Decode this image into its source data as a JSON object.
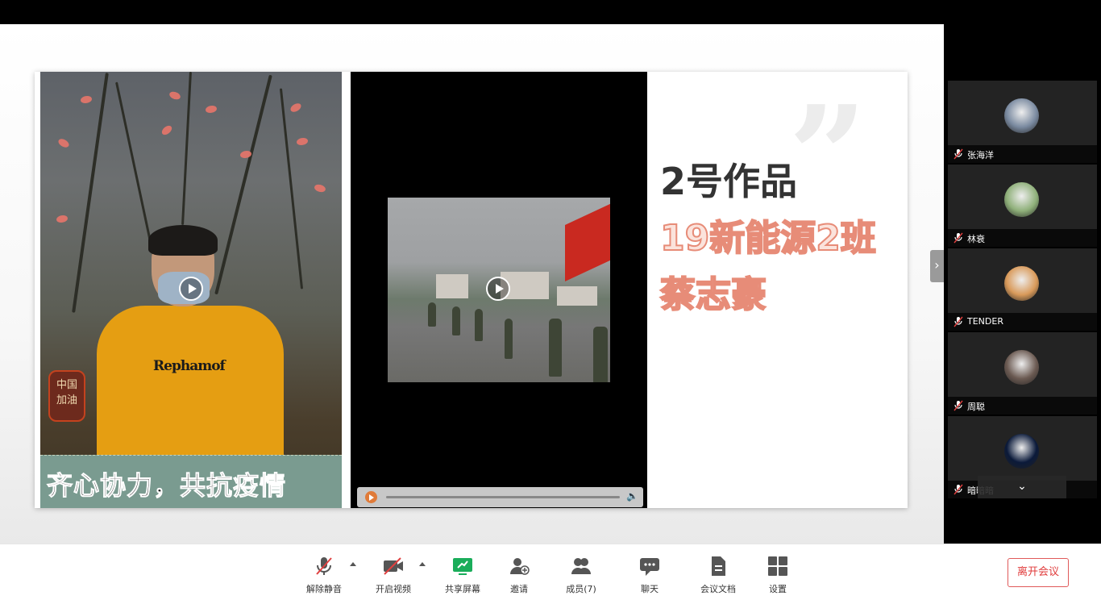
{
  "slide": {
    "caption": "齐心协力，共抗疫情",
    "emblem_text": "中国\n加油",
    "shirt_text": "Rephamof",
    "work_title": "2号作品",
    "work_class": "19新能源2班",
    "work_name": "蔡志豪",
    "quote_mark": "”"
  },
  "participants": [
    {
      "name": "张海洋",
      "avatar_icon": "photo-avatar",
      "color": "#7a8aa0"
    },
    {
      "name": "林衰",
      "avatar_icon": "cartoon-avatar",
      "color": "#8fb07a"
    },
    {
      "name": "TENDER",
      "avatar_icon": "cartoon-avatar",
      "color": "#d99a5a"
    },
    {
      "name": "周聪",
      "avatar_icon": "photo-avatar",
      "color": "#6b5a52"
    },
    {
      "name": "暗暗暗",
      "avatar_icon": "space-avatar",
      "color": "#0b1a3a"
    }
  ],
  "toolbar": {
    "unmute": "解除静音",
    "start_video": "开启视频",
    "share_screen": "共享屏幕",
    "invite": "邀请",
    "members": "成员(7)",
    "chat": "聊天",
    "docs": "会议文档",
    "settings": "设置",
    "leave": "离开会议"
  },
  "colors": {
    "accent_green": "#1aad5a",
    "leave_red": "#e03b3b",
    "muted_red": "#e04040"
  }
}
